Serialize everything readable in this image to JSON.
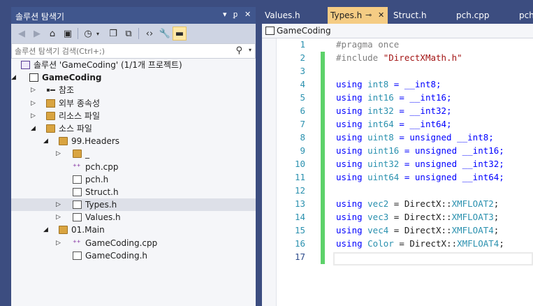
{
  "solution_explorer": {
    "title": "솔루션 탐색기",
    "controls": {
      "dropdown": "▾",
      "pin": "ᵱ",
      "close": "✕"
    },
    "search_placeholder": "솔루션 탐색기 검색(Ctrl+;)",
    "tree": [
      {
        "label": "솔루션 'GameCoding' (1/1개 프로젝트)",
        "icon": "solution-icon",
        "depth": 0,
        "arrow": ""
      },
      {
        "label": "GameCoding",
        "icon": "project-icon",
        "depth": 0,
        "arrow": "◢",
        "bold": true
      },
      {
        "label": "참조",
        "icon": "references-icon",
        "depth": 1,
        "arrow": "▷"
      },
      {
        "label": "외부 종속성",
        "icon": "external-deps-icon",
        "depth": 1,
        "arrow": "▷"
      },
      {
        "label": "리소스 파일",
        "icon": "filter-folder-icon",
        "depth": 1,
        "arrow": "▷"
      },
      {
        "label": "소스 파일",
        "icon": "filter-folder-icon",
        "depth": 1,
        "arrow": "◢"
      },
      {
        "label": "99.Headers",
        "icon": "filter-folder-icon",
        "depth": 2,
        "arrow": "◢"
      },
      {
        "label": "_",
        "icon": "filter-folder-icon",
        "depth": 3,
        "arrow": "▷"
      },
      {
        "label": "pch.cpp",
        "icon": "cpp-file-icon",
        "depth": 3,
        "arrow": ""
      },
      {
        "label": "pch.h",
        "icon": "header-file-icon",
        "depth": 3,
        "arrow": ""
      },
      {
        "label": "Struct.h",
        "icon": "header-file-icon",
        "depth": 3,
        "arrow": ""
      },
      {
        "label": "Types.h",
        "icon": "header-file-icon",
        "depth": 3,
        "arrow": "▷",
        "selected": true
      },
      {
        "label": "Values.h",
        "icon": "header-file-icon",
        "depth": 3,
        "arrow": "▷"
      },
      {
        "label": "01.Main",
        "icon": "filter-folder-icon",
        "depth": 2,
        "arrow": "◢"
      },
      {
        "label": "GameCoding.cpp",
        "icon": "cpp-file-icon",
        "depth": 3,
        "arrow": "▷"
      },
      {
        "label": "GameCoding.h",
        "icon": "header-file-icon",
        "depth": 3,
        "arrow": ""
      }
    ]
  },
  "editor": {
    "tabs": [
      {
        "label": "Values.h"
      },
      {
        "label": "Types.h",
        "pin": "⊸",
        "close": "✕",
        "active": true
      },
      {
        "label": "Struct.h"
      },
      {
        "label": "pch.cpp"
      },
      {
        "label": "pch"
      }
    ],
    "nav_project": "GameCoding",
    "lines": [
      {
        "n": "1",
        "tokens": [
          {
            "t": "#pragma once",
            "c": "pp"
          }
        ]
      },
      {
        "n": "2",
        "tokens": [
          {
            "t": "#include ",
            "c": "pp"
          },
          {
            "t": "\"DirectXMath.h\"",
            "c": "str"
          }
        ]
      },
      {
        "n": "3",
        "tokens": []
      },
      {
        "n": "4",
        "tokens": [
          {
            "t": "using ",
            "c": "kw"
          },
          {
            "t": "int8",
            "c": "ty"
          },
          {
            "t": " = __int8;",
            "c": "kw"
          }
        ]
      },
      {
        "n": "5",
        "tokens": [
          {
            "t": "using ",
            "c": "kw"
          },
          {
            "t": "int16",
            "c": "ty"
          },
          {
            "t": " = __int16;",
            "c": "kw"
          }
        ]
      },
      {
        "n": "6",
        "tokens": [
          {
            "t": "using ",
            "c": "kw"
          },
          {
            "t": "int32",
            "c": "ty"
          },
          {
            "t": " = __int32;",
            "c": "kw"
          }
        ]
      },
      {
        "n": "7",
        "tokens": [
          {
            "t": "using ",
            "c": "kw"
          },
          {
            "t": "int64",
            "c": "ty"
          },
          {
            "t": " = __int64;",
            "c": "kw"
          }
        ]
      },
      {
        "n": "8",
        "tokens": [
          {
            "t": "using ",
            "c": "kw"
          },
          {
            "t": "uint8",
            "c": "ty"
          },
          {
            "t": " = unsigned __int8;",
            "c": "kw"
          }
        ]
      },
      {
        "n": "9",
        "tokens": [
          {
            "t": "using ",
            "c": "kw"
          },
          {
            "t": "uint16",
            "c": "ty"
          },
          {
            "t": " = unsigned __int16;",
            "c": "kw"
          }
        ]
      },
      {
        "n": "10",
        "tokens": [
          {
            "t": "using ",
            "c": "kw"
          },
          {
            "t": "uint32",
            "c": "ty"
          },
          {
            "t": " = unsigned __int32;",
            "c": "kw"
          }
        ]
      },
      {
        "n": "11",
        "tokens": [
          {
            "t": "using ",
            "c": "kw"
          },
          {
            "t": "uint64",
            "c": "ty"
          },
          {
            "t": " = unsigned __int64;",
            "c": "kw"
          }
        ]
      },
      {
        "n": "12",
        "tokens": []
      },
      {
        "n": "13",
        "tokens": [
          {
            "t": "using ",
            "c": "kw"
          },
          {
            "t": "vec2",
            "c": "ty"
          },
          {
            "t": " = DirectX::",
            "c": "plain"
          },
          {
            "t": "XMFLOAT2",
            "c": "ty"
          },
          {
            "t": ";",
            "c": "plain"
          }
        ]
      },
      {
        "n": "14",
        "tokens": [
          {
            "t": "using ",
            "c": "kw"
          },
          {
            "t": "vec3",
            "c": "ty"
          },
          {
            "t": " = DirectX::",
            "c": "plain"
          },
          {
            "t": "XMFLOAT3",
            "c": "ty"
          },
          {
            "t": ";",
            "c": "plain"
          }
        ]
      },
      {
        "n": "15",
        "tokens": [
          {
            "t": "using ",
            "c": "kw"
          },
          {
            "t": "vec4",
            "c": "ty"
          },
          {
            "t": " = DirectX::",
            "c": "plain"
          },
          {
            "t": "XMFLOAT4",
            "c": "ty"
          },
          {
            "t": ";",
            "c": "plain"
          }
        ]
      },
      {
        "n": "16",
        "tokens": [
          {
            "t": "using ",
            "c": "kw"
          },
          {
            "t": "Color",
            "c": "ty"
          },
          {
            "t": " = DirectX::",
            "c": "plain"
          },
          {
            "t": "XMFLOAT4",
            "c": "ty"
          },
          {
            "t": ";",
            "c": "plain"
          }
        ]
      },
      {
        "n": "17",
        "tokens": []
      }
    ]
  }
}
